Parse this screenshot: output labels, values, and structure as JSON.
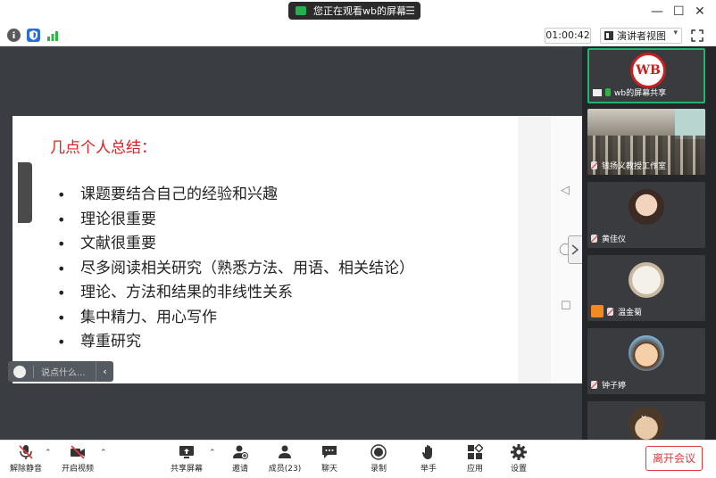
{
  "titlebar": {
    "share_text": "您正在观看wb的屏幕",
    "menu_glyph": "☰",
    "minimize": "—",
    "maximize": "☐",
    "close": "✕"
  },
  "toolbar": {
    "timer": "01:00:42",
    "view_label": "演讲者视图",
    "view_caret": "▾"
  },
  "slide": {
    "title": "几点个人总结：",
    "bullets": [
      "课题要结合自己的经验和兴趣",
      "理论很重要",
      "文献很重要",
      "尽多阅读相关研究（熟悉方法、用语、相关结论）",
      "理论、方法和结果的非线性关系",
      "集中精力、用心写作",
      "尊重研究"
    ]
  },
  "chat": {
    "placeholder": "说点什么...",
    "arrow": "‹"
  },
  "side_controls": {
    "prev": "◁",
    "circle": "◯",
    "square": "☐"
  },
  "participants": [
    {
      "name": "wb的屏幕共享",
      "logo": "WB"
    },
    {
      "name": "钱扬义教授工作室"
    },
    {
      "name": "黄佳仪"
    },
    {
      "name": "温金菊"
    },
    {
      "name": "钟子婷"
    }
  ],
  "scroll_down": "⌄",
  "bottombar": {
    "unmute": "解除静音",
    "start_video": "开启视频",
    "share_screen": "共享屏幕",
    "invite": "邀请",
    "members": "成员(23)",
    "chat": "聊天",
    "record": "录制",
    "raise_hand": "举手",
    "apps": "应用",
    "settings": "设置",
    "caret": "⌃",
    "leave": "离开会议"
  },
  "colors": {
    "accent_red": "#e4393c",
    "active_green": "#24b36b",
    "slide_title_red": "#e02020",
    "stage_bg": "#3a3d42",
    "panel_bg": "#252629"
  }
}
